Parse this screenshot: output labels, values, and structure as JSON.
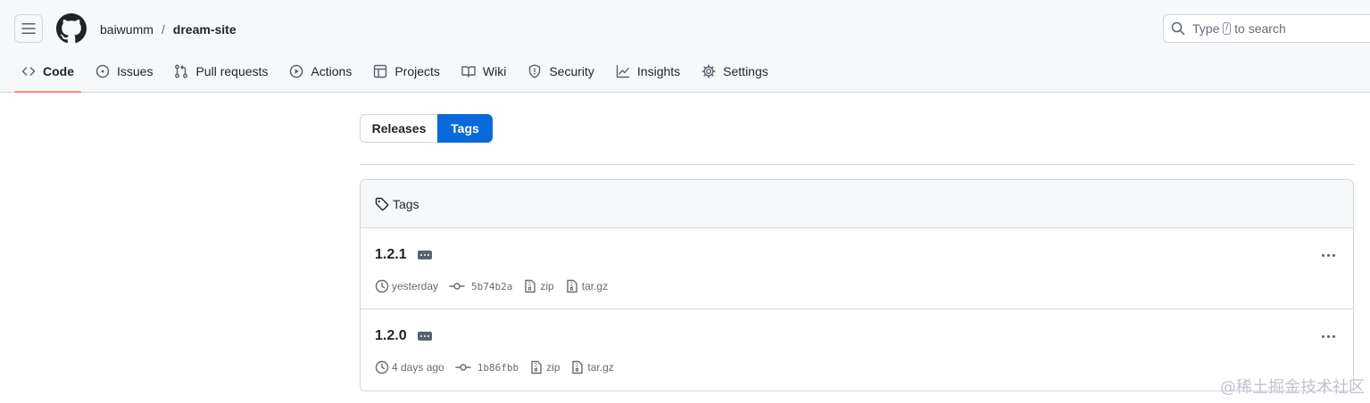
{
  "header": {
    "owner": "baiwumm",
    "separator": "/",
    "repo": "dream-site",
    "search": {
      "prefix": "Type",
      "key": "/",
      "suffix": "to search"
    }
  },
  "tabs": [
    {
      "label": "Code",
      "icon": "code-icon",
      "active": true
    },
    {
      "label": "Issues",
      "icon": "issue-opened-icon"
    },
    {
      "label": "Pull requests",
      "icon": "git-pull-request-icon"
    },
    {
      "label": "Actions",
      "icon": "play-icon"
    },
    {
      "label": "Projects",
      "icon": "table-icon"
    },
    {
      "label": "Wiki",
      "icon": "book-icon"
    },
    {
      "label": "Security",
      "icon": "shield-icon"
    },
    {
      "label": "Insights",
      "icon": "graph-icon"
    },
    {
      "label": "Settings",
      "icon": "gear-icon"
    }
  ],
  "segmented": {
    "releases": "Releases",
    "tags": "Tags",
    "selected": "Tags"
  },
  "tags_box": {
    "title": "Tags",
    "items": [
      {
        "name": "1.2.1",
        "date": "yesterday",
        "sha": "5b74b2a",
        "zip": "zip",
        "targz": "tar.gz"
      },
      {
        "name": "1.2.0",
        "date": "4 days ago",
        "sha": "1b86fbb",
        "zip": "zip",
        "targz": "tar.gz"
      }
    ]
  },
  "watermark": "@稀土掘金技术社区",
  "colors": {
    "accent": "#0969da",
    "active_underline": "#fd8c73",
    "border": "#d0d7de",
    "muted": "#656d76"
  }
}
